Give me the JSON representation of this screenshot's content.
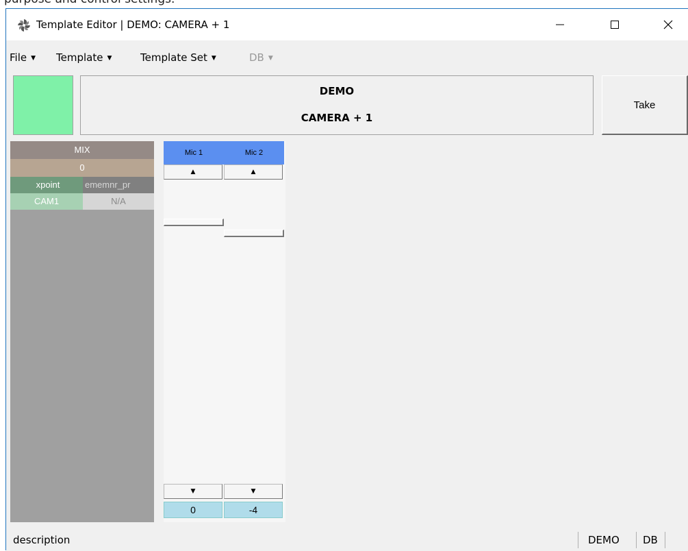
{
  "window": {
    "title": "Template Editor | DEMO: CAMERA + 1",
    "top_fragment": "purpose and control settings."
  },
  "menu": [
    {
      "label": "File",
      "enabled": true
    },
    {
      "label": "Template",
      "enabled": true
    },
    {
      "label": "Template Set",
      "enabled": true
    },
    {
      "label": "DB",
      "enabled": false
    }
  ],
  "header": {
    "color": "#7ff1a8",
    "line1": "DEMO",
    "line2": "CAMERA + 1",
    "take_label": "Take"
  },
  "mix": {
    "title": "MIX",
    "value": "0",
    "columns": [
      "xpoint",
      "ememnr_pr"
    ],
    "row": [
      "CAM1",
      "N/A"
    ]
  },
  "mics": [
    {
      "label": "Mic 1",
      "value": "0",
      "up": "▲",
      "down": "▼"
    },
    {
      "label": "Mic 2",
      "value": "-4",
      "up": "▲",
      "down": "▼"
    }
  ],
  "status": {
    "description": "description",
    "template_set": "DEMO",
    "db": "DB"
  },
  "icons": {
    "app": "pinwheel-icon",
    "minimize": "minimize-icon",
    "maximize": "maximize-icon",
    "close": "close-icon"
  }
}
